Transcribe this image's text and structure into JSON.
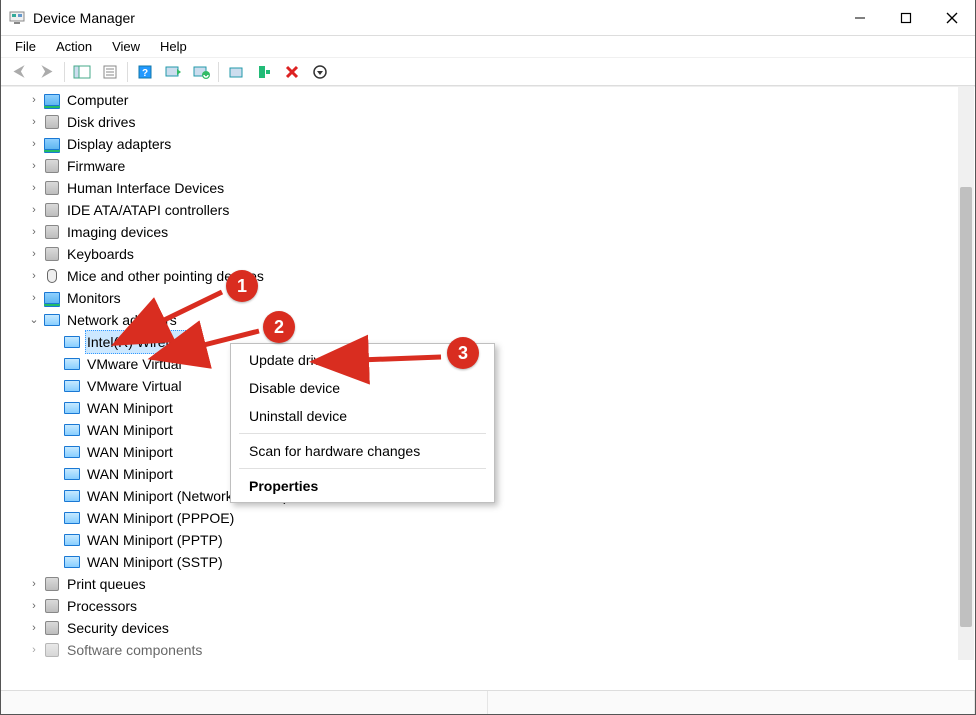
{
  "window": {
    "title": "Device Manager"
  },
  "menu": {
    "file": "File",
    "action": "Action",
    "view": "View",
    "help": "Help"
  },
  "toolbar": {
    "back": "back-icon",
    "forward": "forward-icon",
    "show_hide": "show-hide-tree-icon",
    "properties": "properties-icon",
    "help": "help-icon",
    "scan": "scan-hardware-icon",
    "update": "update-driver-icon",
    "enable": "enable-device-icon",
    "add": "add-hardware-icon",
    "uninstall": "uninstall-icon",
    "down": "down-arrow-icon"
  },
  "tree": {
    "items": [
      {
        "label": "Computer",
        "icon": "computer-icon",
        "expandable": true
      },
      {
        "label": "Disk drives",
        "icon": "disk-icon",
        "expandable": true
      },
      {
        "label": "Display adapters",
        "icon": "display-icon",
        "expandable": true
      },
      {
        "label": "Firmware",
        "icon": "firmware-icon",
        "expandable": true
      },
      {
        "label": "Human Interface Devices",
        "icon": "hid-icon",
        "expandable": true
      },
      {
        "label": "IDE ATA/ATAPI controllers",
        "icon": "ide-icon",
        "expandable": true
      },
      {
        "label": "Imaging devices",
        "icon": "imaging-icon",
        "expandable": true
      },
      {
        "label": "Keyboards",
        "icon": "keyboard-icon",
        "expandable": true
      },
      {
        "label": "Mice and other pointing devices",
        "icon": "mouse-icon",
        "expandable": true
      },
      {
        "label": "Monitors",
        "icon": "monitor-icon",
        "expandable": true
      },
      {
        "label": "Network adapters",
        "icon": "network-icon",
        "expandable": true,
        "expanded": true,
        "children": [
          {
            "label": "Intel(R) Wireless",
            "icon": "net-adapter-icon",
            "selected": true
          },
          {
            "label": "VMware Virtual",
            "icon": "net-adapter-icon"
          },
          {
            "label": "VMware Virtual",
            "icon": "net-adapter-icon"
          },
          {
            "label": "WAN Miniport",
            "icon": "net-adapter-icon"
          },
          {
            "label": "WAN Miniport",
            "icon": "net-adapter-icon"
          },
          {
            "label": "WAN Miniport",
            "icon": "net-adapter-icon"
          },
          {
            "label": "WAN Miniport",
            "icon": "net-adapter-icon"
          },
          {
            "label": "WAN Miniport (Network Monitor)",
            "icon": "net-adapter-icon",
            "truncated": true
          },
          {
            "label": "WAN Miniport (PPPOE)",
            "icon": "net-adapter-icon"
          },
          {
            "label": "WAN Miniport (PPTP)",
            "icon": "net-adapter-icon"
          },
          {
            "label": "WAN Miniport (SSTP)",
            "icon": "net-adapter-icon"
          }
        ]
      },
      {
        "label": "Print queues",
        "icon": "printer-icon",
        "expandable": true
      },
      {
        "label": "Processors",
        "icon": "cpu-icon",
        "expandable": true
      },
      {
        "label": "Security devices",
        "icon": "security-icon",
        "expandable": true
      },
      {
        "label": "Software components",
        "icon": "software-icon",
        "expandable": true
      }
    ]
  },
  "context_menu": {
    "update": "Update driver",
    "disable": "Disable device",
    "uninstall": "Uninstall device",
    "scan": "Scan for hardware changes",
    "properties": "Properties"
  },
  "annotations": {
    "step1": "1",
    "step2": "2",
    "step3": "3"
  }
}
